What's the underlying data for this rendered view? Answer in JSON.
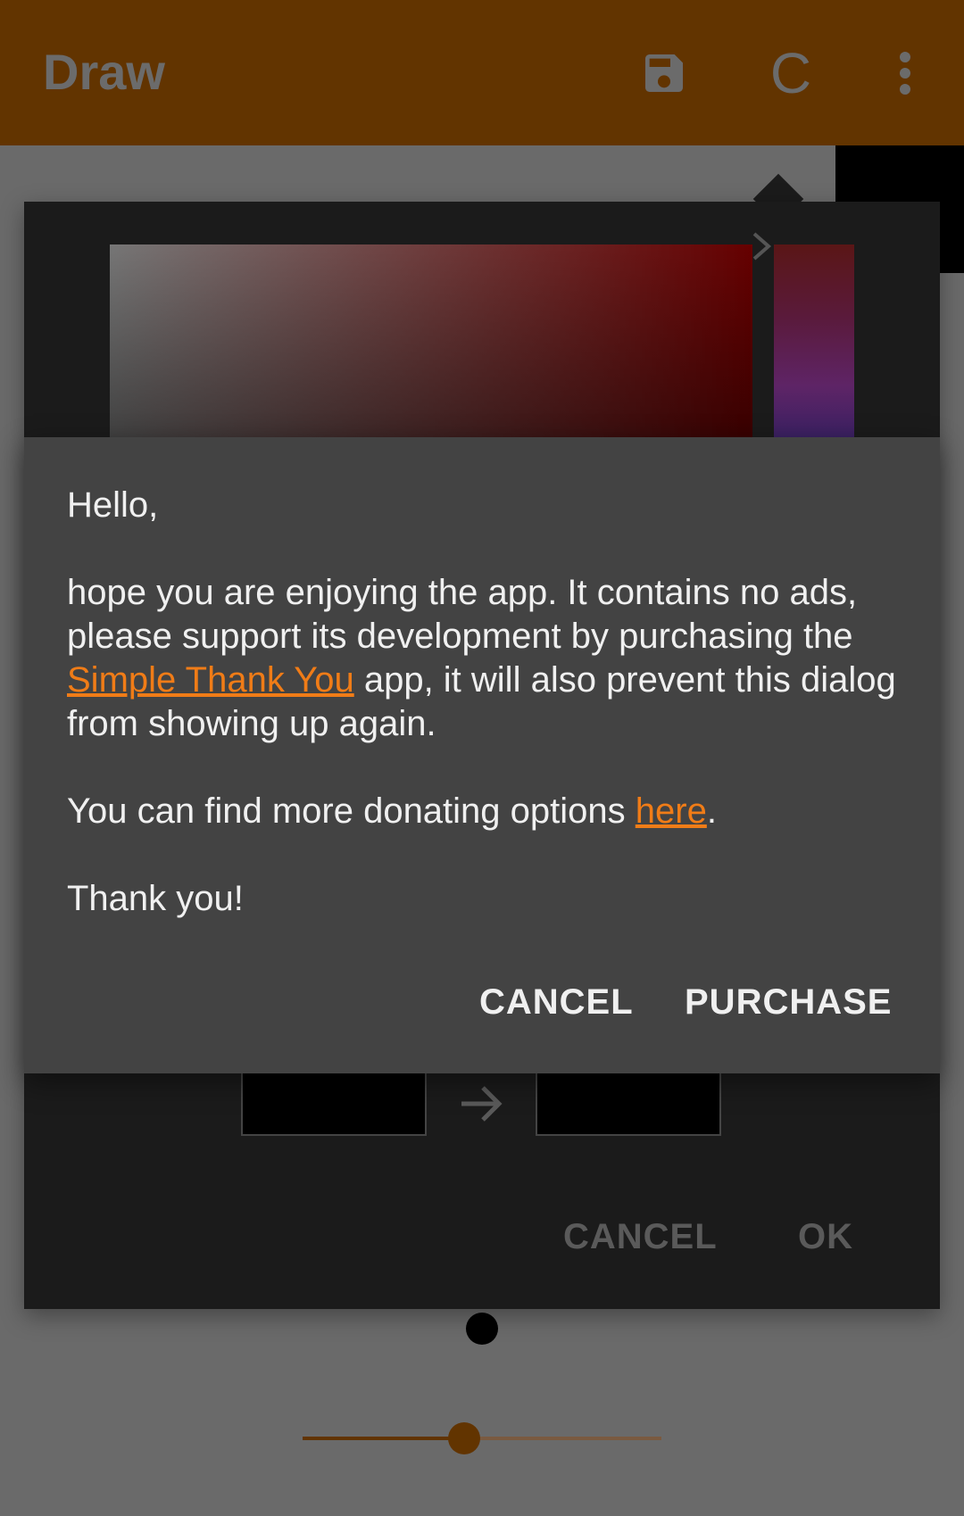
{
  "toolbar": {
    "title": "Draw",
    "save_icon": "save-icon",
    "clear_label": "C",
    "more_icon": "more-vert-icon",
    "background_color": "#623400"
  },
  "color_picker": {
    "hue_chevron_icon": "chevron-right-icon",
    "arrow_icon": "arrow-right-icon",
    "cancel_label": "CANCEL",
    "ok_label": "OK",
    "old_color": "#000000",
    "new_color": "#000000"
  },
  "donate_dialog": {
    "greeting": "Hello,",
    "body_part1": "hope you are enjoying the app. It contains no ads, please support its development by purchasing the ",
    "link_thank_you": "Simple Thank You",
    "body_part2": " app, it will also prevent this dialog from showing up again.",
    "donate_part1": "You can find more donating options ",
    "link_here": "here",
    "donate_part2": ".",
    "thanks": "Thank you!",
    "cancel_label": "CANCEL",
    "purchase_label": "PURCHASE",
    "link_color": "#f07c17"
  },
  "brush": {
    "size_slider_value": 0.45,
    "preview_color": "#000000"
  }
}
